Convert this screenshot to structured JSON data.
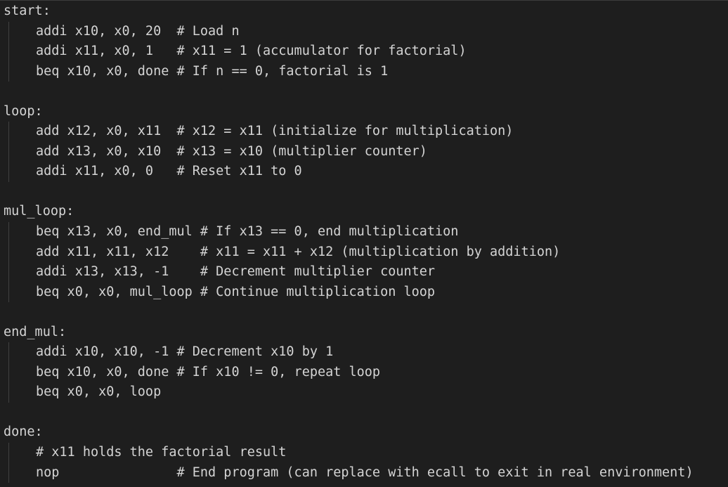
{
  "editor": {
    "lines": [
      {
        "text": "start:",
        "indent": false
      },
      {
        "text": "addi x10, x0, 20  # Load n",
        "indent": true
      },
      {
        "text": "addi x11, x0, 1   # x11 = 1 (accumulator for factorial)",
        "indent": true
      },
      {
        "text": "beq x10, x0, done # If n == 0, factorial is 1",
        "indent": true
      },
      {
        "text": "",
        "indent": false
      },
      {
        "text": "loop:",
        "indent": false
      },
      {
        "text": "add x12, x0, x11  # x12 = x11 (initialize for multiplication)",
        "indent": true
      },
      {
        "text": "add x13, x0, x10  # x13 = x10 (multiplier counter)",
        "indent": true
      },
      {
        "text": "addi x11, x0, 0   # Reset x11 to 0",
        "indent": true
      },
      {
        "text": "",
        "indent": false
      },
      {
        "text": "mul_loop:",
        "indent": false
      },
      {
        "text": "beq x13, x0, end_mul # If x13 == 0, end multiplication",
        "indent": true
      },
      {
        "text": "add x11, x11, x12    # x11 = x11 + x12 (multiplication by addition)",
        "indent": true
      },
      {
        "text": "addi x13, x13, -1    # Decrement multiplier counter",
        "indent": true
      },
      {
        "text": "beq x0, x0, mul_loop # Continue multiplication loop",
        "indent": true
      },
      {
        "text": "",
        "indent": false
      },
      {
        "text": "end_mul:",
        "indent": false
      },
      {
        "text": "addi x10, x10, -1 # Decrement x10 by 1",
        "indent": true
      },
      {
        "text": "beq x10, x0, done # If x10 != 0, repeat loop",
        "indent": true
      },
      {
        "text": "beq x0, x0, loop",
        "indent": true
      },
      {
        "text": "",
        "indent": false
      },
      {
        "text": "done:",
        "indent": false
      },
      {
        "text": "# x11 holds the factorial result",
        "indent": true
      },
      {
        "text": "nop               # End program (can replace with ecall to exit in real environment)",
        "indent": true
      }
    ]
  }
}
